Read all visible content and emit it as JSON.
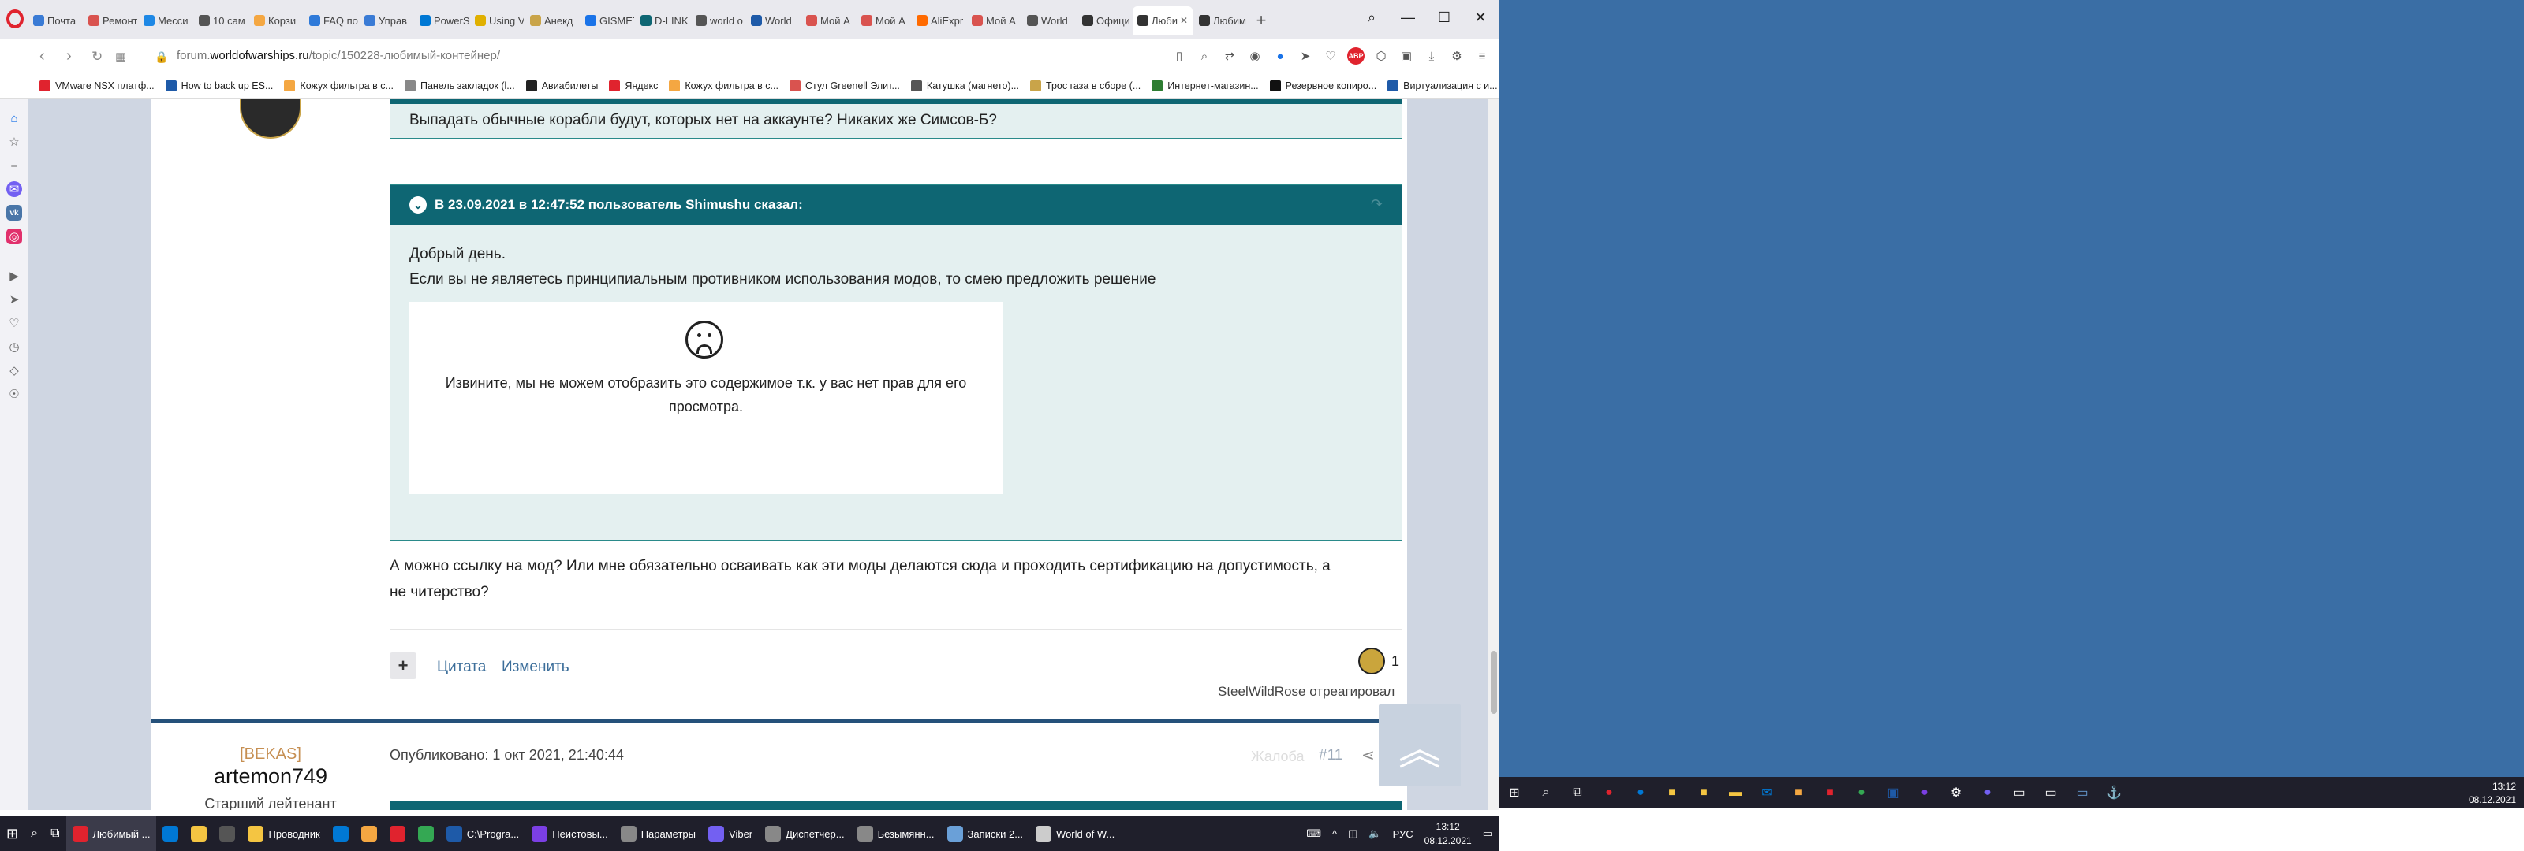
{
  "browser": {
    "tabs": [
      {
        "label": "Почта",
        "color": "#3a7bd5"
      },
      {
        "label": "Ремонт",
        "color": "#d9534f"
      },
      {
        "label": "Месси",
        "color": "#1e88e5"
      },
      {
        "label": "10 сам",
        "color": "#555555"
      },
      {
        "label": "Корзи",
        "color": "#f4a742"
      },
      {
        "label": "FAQ по",
        "color": "#2f7ad9"
      },
      {
        "label": "Управ",
        "color": "#3a7bd5"
      },
      {
        "label": "PowerS",
        "color": "#0078d4"
      },
      {
        "label": "Using V",
        "color": "#e0b000"
      },
      {
        "label": "Анекд",
        "color": "#c9a449"
      },
      {
        "label": "GISMET",
        "color": "#1a73e8"
      },
      {
        "label": "D-LINK",
        "color": "#0e6673"
      },
      {
        "label": "world o",
        "color": "#555555"
      },
      {
        "label": "World",
        "color": "#1e5aa8"
      },
      {
        "label": "Мой A",
        "color": "#d9534f"
      },
      {
        "label": "Мой A",
        "color": "#d9534f"
      },
      {
        "label": "AliExpr",
        "color": "#ff6a00"
      },
      {
        "label": "Мой A",
        "color": "#d9534f"
      },
      {
        "label": "World",
        "color": "#555555"
      },
      {
        "label": "Офици",
        "color": "#333333"
      },
      {
        "label": "Люби",
        "color": "#333333",
        "active": true
      },
      {
        "label": "Любим",
        "color": "#333333"
      }
    ],
    "url_prefix": "forum.",
    "url_domain": "worldofwarships.ru",
    "url_path": "/topic/150228-любимый-контейнер/",
    "bookmarks": [
      {
        "label": "VMware NSX платф...",
        "color": "#e0232e"
      },
      {
        "label": "How to back up ES...",
        "color": "#1e5aa8"
      },
      {
        "label": "Кожух фильтра в с...",
        "color": "#f4a742"
      },
      {
        "label": "Панель закладок (l...",
        "color": "#888888"
      },
      {
        "label": "Авиабилеты",
        "color": "#222222"
      },
      {
        "label": "Яндекс",
        "color": "#e0232e"
      },
      {
        "label": "Кожух фильтра в с...",
        "color": "#f4a742"
      },
      {
        "label": "Стул Greenell Элит...",
        "color": "#d9534f"
      },
      {
        "label": "Катушка (магнето)...",
        "color": "#555555"
      },
      {
        "label": "Трос газа в сборе (...",
        "color": "#c9a449"
      },
      {
        "label": "Интернет-магазин...",
        "color": "#2e7d32"
      },
      {
        "label": "Резервное копиро...",
        "color": "#111111"
      },
      {
        "label": "Виртуализация с и...",
        "color": "#1e5aa8"
      }
    ]
  },
  "forum": {
    "quote1_text": "Выпадать обычные корабли будут, которых нет на аккаунте? Никаких же Симсов-Б?",
    "quote2_header": "В 23.09.2021 в 12:47:52 пользователь Shimushu сказал:",
    "quote2_line1": "Добрый день.",
    "quote2_line2": "Если вы не являетесь принципиальным противником использования модов, то смею предложить решение",
    "no_permission": "Извините, мы не можем отобразить это содержимое т.к. у вас нет прав для его просмотра.",
    "post_text": "А можно ссылку на мод? Или мне обязательно осваивать как эти моды делаются сюда и проходить сертификацию на допустимость, а не читерство?",
    "quote_link": "Цитата",
    "edit_link": "Изменить",
    "reaction_count": "1",
    "reacted_by": "SteelWildRose отреагировал",
    "next_post": {
      "rank": "[BEKAS]",
      "username": "artemon749",
      "user_title": "Старший лейтенант",
      "published": "Опубликовано: 1 окт 2021, 21:40:44",
      "complain": "Жалоба",
      "post_number": "#11"
    }
  },
  "taskbar": {
    "items": [
      {
        "label": "Любимый ...",
        "color": "#e0232e",
        "active": true
      },
      {
        "label": "",
        "color": "#0078d4"
      },
      {
        "label": "",
        "color": "#f4c542"
      },
      {
        "label": "",
        "color": "#555555"
      },
      {
        "label": "Проводник",
        "color": "#f4c542"
      },
      {
        "label": "",
        "color": "#0078d4"
      },
      {
        "label": "",
        "color": "#f4a742"
      },
      {
        "label": "",
        "color": "#e0232e"
      },
      {
        "label": "",
        "color": "#34a853"
      },
      {
        "label": "C:\\Progra...",
        "color": "#1e5aa8"
      },
      {
        "label": "Неистовы...",
        "color": "#7b3fe4"
      },
      {
        "label": "Параметры",
        "color": "#888888"
      },
      {
        "label": "Viber",
        "color": "#7360f2"
      },
      {
        "label": "Диспетчер...",
        "color": "#888888"
      },
      {
        "label": "Безымянн...",
        "color": "#888888"
      },
      {
        "label": "Записки 2...",
        "color": "#6aa0d8"
      },
      {
        "label": "World of W...",
        "color": "#cccccc"
      }
    ],
    "lang": "РУС",
    "time": "13:12",
    "date": "08.12.2021"
  }
}
